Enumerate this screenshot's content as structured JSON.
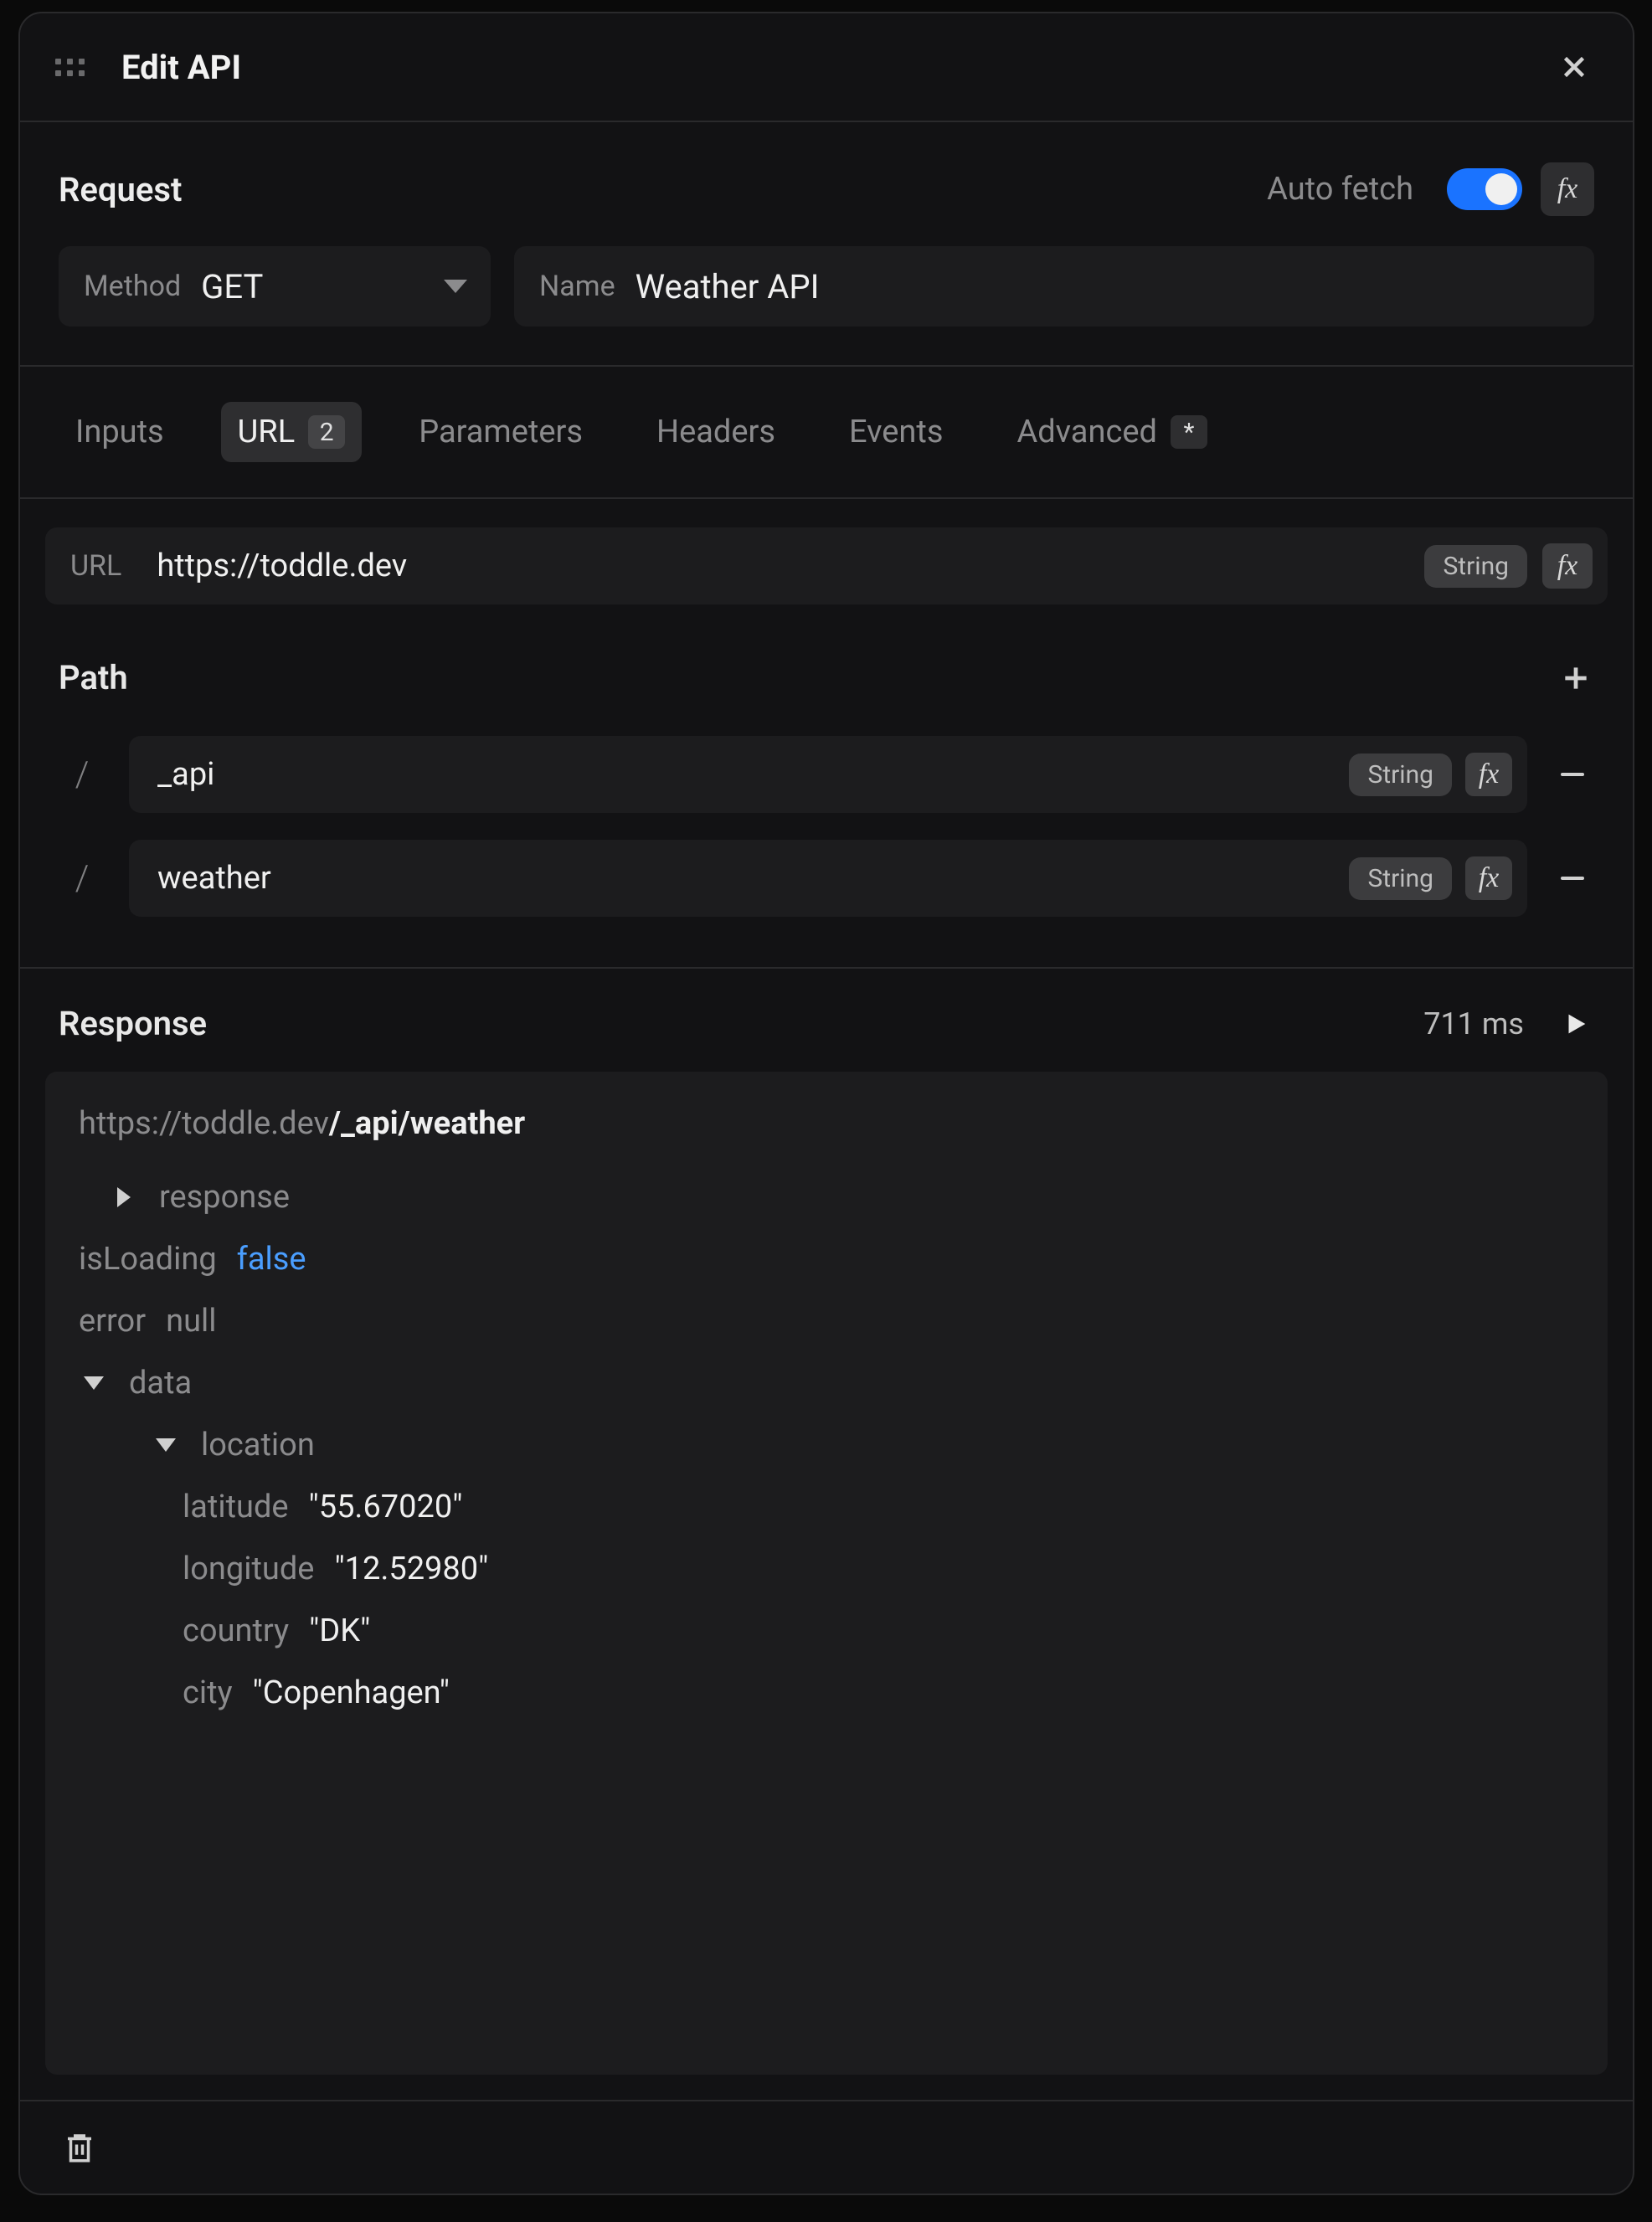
{
  "header": {
    "title": "Edit API"
  },
  "request": {
    "section_label": "Request",
    "auto_fetch_label": "Auto fetch",
    "auto_fetch_on": true,
    "method_label": "Method",
    "method_value": "GET",
    "name_label": "Name",
    "name_value": "Weather API"
  },
  "tabs": {
    "inputs": "Inputs",
    "url": "URL",
    "url_badge": "2",
    "parameters": "Parameters",
    "headers": "Headers",
    "events": "Events",
    "advanced": "Advanced",
    "advanced_badge": "*"
  },
  "url": {
    "label": "URL",
    "value": "https://toddle.dev",
    "type": "String"
  },
  "path": {
    "title": "Path",
    "segments": [
      {
        "value": "_api",
        "type": "String"
      },
      {
        "value": "weather",
        "type": "String"
      }
    ]
  },
  "response": {
    "title": "Response",
    "time_ms": "711 ms",
    "url_base": "https://toddle.dev",
    "url_path": "/_api/weather",
    "response_key": "response",
    "isLoading_key": "isLoading",
    "isLoading_val": "false",
    "error_key": "error",
    "error_val": "null",
    "data_key": "data",
    "location_key": "location",
    "latitude_key": "latitude",
    "latitude_val": "\"55.67020\"",
    "longitude_key": "longitude",
    "longitude_val": "\"12.52980\"",
    "country_key": "country",
    "country_val": "\"DK\"",
    "city_key": "city",
    "city_val": "\"Copenhagen\""
  }
}
